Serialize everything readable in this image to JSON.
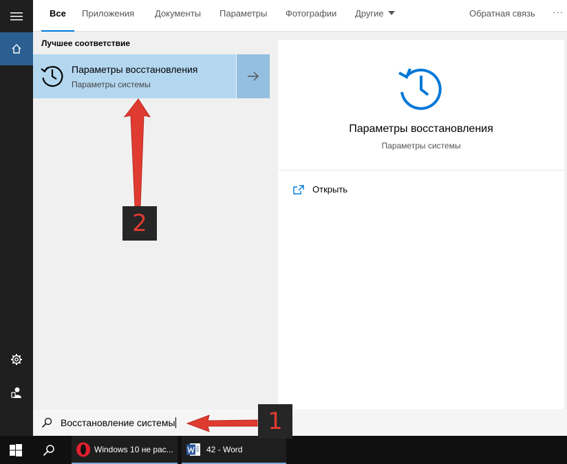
{
  "tabs": {
    "all": "Все",
    "apps": "Приложения",
    "documents": "Документы",
    "settings": "Параметры",
    "photos": "Фотографии",
    "other": "Другие",
    "feedback": "Обратная связь",
    "more": "···"
  },
  "results": {
    "section_title": "Лучшее соответствие",
    "best_title": "Параметры восстановления",
    "best_subtitle": "Параметры системы"
  },
  "preview": {
    "title": "Параметры восстановления",
    "subtitle": "Параметры системы",
    "open_label": "Открыть"
  },
  "search": {
    "query": "Восстановление системы"
  },
  "taskbar": {
    "opera_label": "Windows 10 не рас...",
    "word_label": "42 - Word"
  },
  "annotations": {
    "badge1": "1",
    "badge2": "2"
  },
  "colors": {
    "accent": "#0078d7",
    "selected": "#b4d7f0",
    "annotation_red": "#e03b30"
  },
  "icons": [
    "hamburger-icon",
    "home-icon",
    "gear-icon",
    "user-icon",
    "history-icon",
    "arrow-right-icon",
    "open-icon",
    "search-icon",
    "windows-icon",
    "opera-icon",
    "word-icon"
  ]
}
